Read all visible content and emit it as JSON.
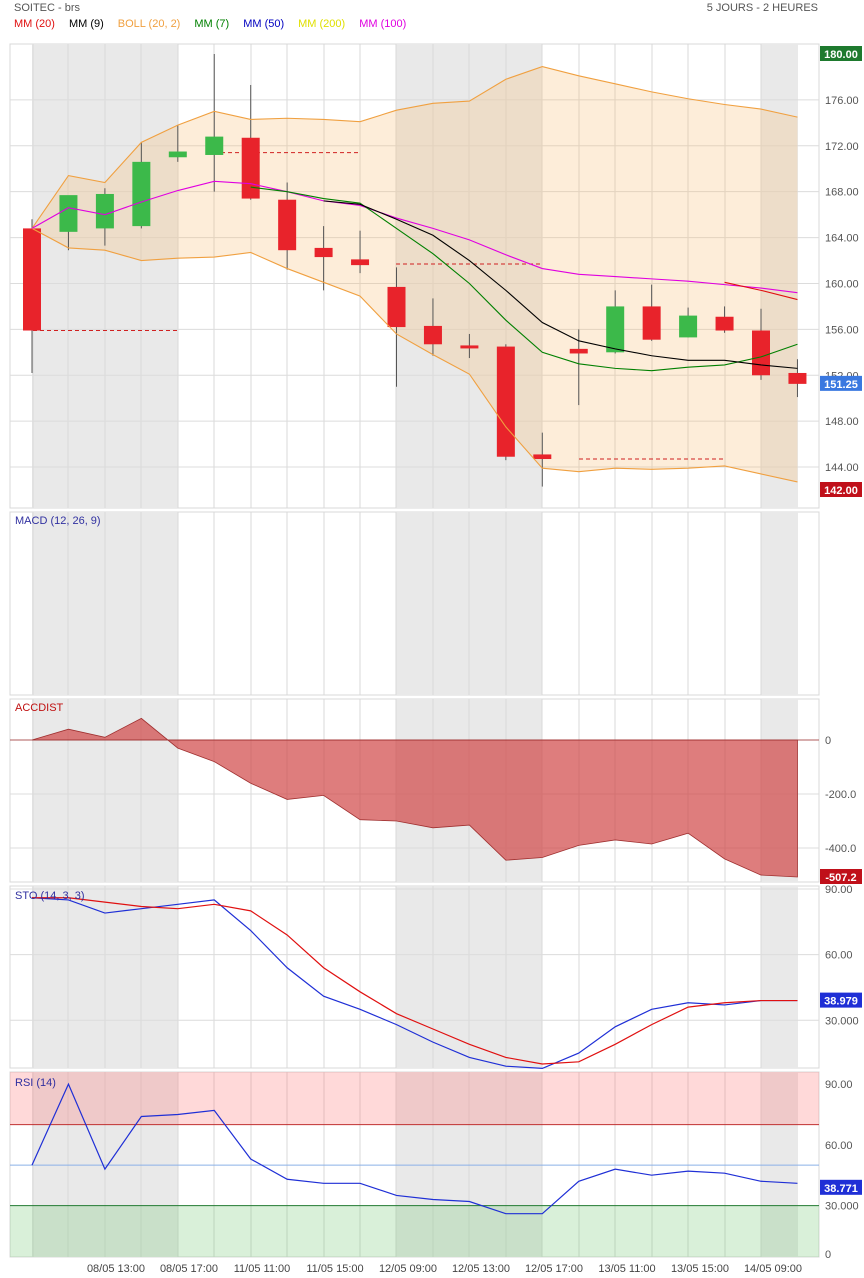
{
  "header": {
    "title": "SOITEC - brs",
    "period": "5 JOURS - 2 HEURES"
  },
  "legend": [
    {
      "label": "MM (20)",
      "color": "#e01010"
    },
    {
      "label": "MM (9)",
      "color": "#000000"
    },
    {
      "label": "BOLL (20, 2)",
      "color": "#f0a040"
    },
    {
      "label": "MM (7)",
      "color": "#008000"
    },
    {
      "label": "MM (50)",
      "color": "#0000c0"
    },
    {
      "label": "MM (200)",
      "color": "#e0e000"
    },
    {
      "label": "MM (100)",
      "color": "#e000e0"
    }
  ],
  "x_labels": [
    "08/05 13:00",
    "08/05 17:00",
    "11/05 11:00",
    "11/05 15:00",
    "12/05 09:00",
    "12/05 13:00",
    "12/05 17:00",
    "13/05 11:00",
    "13/05 15:00",
    "14/05 09:00"
  ],
  "chart_data": [
    {
      "type": "candlestick",
      "title": "SOITEC - brs",
      "ylim": [
        142,
        180
      ],
      "y_ticks": [
        "144.00",
        "148.00",
        "152.00",
        "156.00",
        "160.00",
        "164.00",
        "168.00",
        "172.00",
        "176.00"
      ],
      "top_label": "180.00",
      "bottom_label": "142.00",
      "last_label": "151.25",
      "last_value": 151.25,
      "candles": [
        {
          "o": 164.8,
          "h": 165.6,
          "l": 152.2,
          "c": 155.9
        },
        {
          "o": 164.5,
          "h": 167.5,
          "l": 162.9,
          "c": 167.7
        },
        {
          "o": 164.8,
          "h": 168.3,
          "l": 163.3,
          "c": 167.8
        },
        {
          "o": 165.0,
          "h": 172.3,
          "l": 164.8,
          "c": 170.6
        },
        {
          "o": 171.0,
          "h": 173.8,
          "l": 170.6,
          "c": 171.5
        },
        {
          "o": 171.2,
          "h": 180.0,
          "l": 168.0,
          "c": 172.8
        },
        {
          "o": 172.7,
          "h": 177.3,
          "l": 167.3,
          "c": 167.4
        },
        {
          "o": 167.3,
          "h": 168.8,
          "l": 161.2,
          "c": 162.9
        },
        {
          "o": 163.1,
          "h": 165.0,
          "l": 159.4,
          "c": 162.3
        },
        {
          "o": 162.1,
          "h": 164.6,
          "l": 160.9,
          "c": 161.6
        },
        {
          "o": 159.7,
          "h": 161.4,
          "l": 151.0,
          "c": 156.2
        },
        {
          "o": 156.3,
          "h": 158.7,
          "l": 153.7,
          "c": 154.7
        },
        {
          "o": 154.6,
          "h": 155.6,
          "l": 153.5,
          "c": 154.4
        },
        {
          "o": 154.5,
          "h": 154.7,
          "l": 144.6,
          "c": 144.9
        },
        {
          "o": 145.1,
          "h": 147.0,
          "l": 142.3,
          "c": 144.7
        },
        {
          "o": 154.3,
          "h": 156.0,
          "l": 149.4,
          "c": 153.9
        },
        {
          "o": 154.0,
          "h": 159.4,
          "l": 153.9,
          "c": 158.0
        },
        {
          "o": 158.0,
          "h": 159.9,
          "l": 155.0,
          "c": 155.1
        },
        {
          "o": 155.3,
          "h": 157.9,
          "l": 155.3,
          "c": 157.2
        },
        {
          "o": 157.1,
          "h": 158.0,
          "l": 155.7,
          "c": 155.9
        },
        {
          "o": 155.9,
          "h": 157.8,
          "l": 151.6,
          "c": 152.0
        },
        {
          "o": 152.2,
          "h": 153.4,
          "l": 150.1,
          "c": 151.25
        }
      ],
      "series": [
        {
          "legend_ref": "BOLL (20, 2)",
          "role": "upper",
          "values": [
            164.8,
            169.4,
            168.8,
            172.3,
            173.8,
            175.0,
            174.3,
            174.4,
            174.3,
            174.1,
            175.1,
            175.7,
            175.9,
            177.8,
            178.9,
            178.1,
            177.4,
            176.7,
            176.1,
            175.6,
            175.2,
            174.5
          ]
        },
        {
          "legend_ref": "BOLL (20, 2)",
          "role": "lower",
          "values": [
            164.8,
            163.1,
            162.9,
            162.0,
            162.2,
            162.3,
            162.7,
            161.3,
            160.1,
            158.9,
            155.6,
            153.8,
            152.1,
            147.5,
            143.9,
            143.6,
            143.9,
            143.8,
            143.9,
            144.1,
            143.4,
            142.7
          ]
        },
        {
          "legend_ref": "MM (100)",
          "values": [
            164.8,
            166.6,
            166.0,
            167.1,
            168.1,
            168.9,
            168.7,
            168.0,
            167.2,
            166.8,
            165.7,
            164.8,
            163.8,
            162.5,
            161.3,
            160.8,
            160.6,
            160.4,
            160.2,
            159.9,
            159.6,
            159.2
          ]
        },
        {
          "legend_ref": "MM (7)",
          "values": [
            null,
            null,
            null,
            null,
            null,
            null,
            168.4,
            168.0,
            167.4,
            167.0,
            164.8,
            162.6,
            160.0,
            156.8,
            154.0,
            153.0,
            152.6,
            152.4,
            152.7,
            152.9,
            153.6,
            154.7
          ]
        },
        {
          "legend_ref": "MM (9)",
          "values": [
            null,
            null,
            null,
            null,
            null,
            null,
            null,
            null,
            167.2,
            166.9,
            165.6,
            164.2,
            162.0,
            159.4,
            156.6,
            155.0,
            154.3,
            153.7,
            153.3,
            153.3,
            152.9,
            152.6
          ]
        },
        {
          "legend_ref": "MM (20)",
          "values": [
            null,
            null,
            null,
            null,
            null,
            null,
            null,
            null,
            null,
            null,
            null,
            null,
            null,
            null,
            null,
            null,
            null,
            null,
            null,
            160.1,
            159.4,
            158.6
          ]
        }
      ]
    },
    {
      "type": "line",
      "title": "MACD (12, 26, 9)",
      "series": []
    },
    {
      "type": "area",
      "title": "ACCDIST",
      "ylim": [
        -507.2,
        0
      ],
      "y_ticks": [
        "0",
        "-200.0",
        "-400.0"
      ],
      "last_label": "-507.2",
      "last_value": -507.2,
      "values": [
        0,
        40,
        10,
        80,
        -30,
        -80,
        -160,
        -220,
        -205,
        -295,
        -300,
        -325,
        -315,
        -445,
        -435,
        -390,
        -370,
        -385,
        -345,
        -440,
        -500,
        -507.2
      ]
    },
    {
      "type": "line",
      "title": "STO (14, 3, 3)",
      "ylim": [
        10,
        90
      ],
      "y_ticks": [
        "90.00",
        "60.00",
        "30.000"
      ],
      "last_label": "38.979",
      "last_value": 38.979,
      "series": [
        {
          "color": "blue",
          "values": [
            86,
            85,
            79,
            81,
            83,
            85,
            71,
            54,
            41,
            35,
            28,
            20,
            13,
            9,
            8,
            15,
            27,
            35,
            38,
            37,
            39,
            39
          ]
        },
        {
          "color": "red",
          "values": [
            86,
            86,
            84,
            82,
            81,
            83,
            80,
            69,
            54,
            43,
            33,
            26,
            19,
            13,
            10,
            11,
            19,
            28,
            36,
            38,
            39,
            39
          ]
        }
      ]
    },
    {
      "type": "line",
      "title": "RSI (14)",
      "ylim": [
        10,
        95
      ],
      "y_ticks": [
        "90.00",
        "60.00",
        "30.000",
        "0"
      ],
      "last_label": "38.771",
      "last_value": 38.771,
      "series": [
        {
          "color": "blue",
          "values": [
            50,
            90,
            48,
            74,
            75,
            77,
            53,
            43,
            41,
            41,
            35,
            33,
            32,
            26,
            26,
            42,
            48,
            45,
            47,
            46,
            42,
            41
          ]
        }
      ]
    }
  ]
}
